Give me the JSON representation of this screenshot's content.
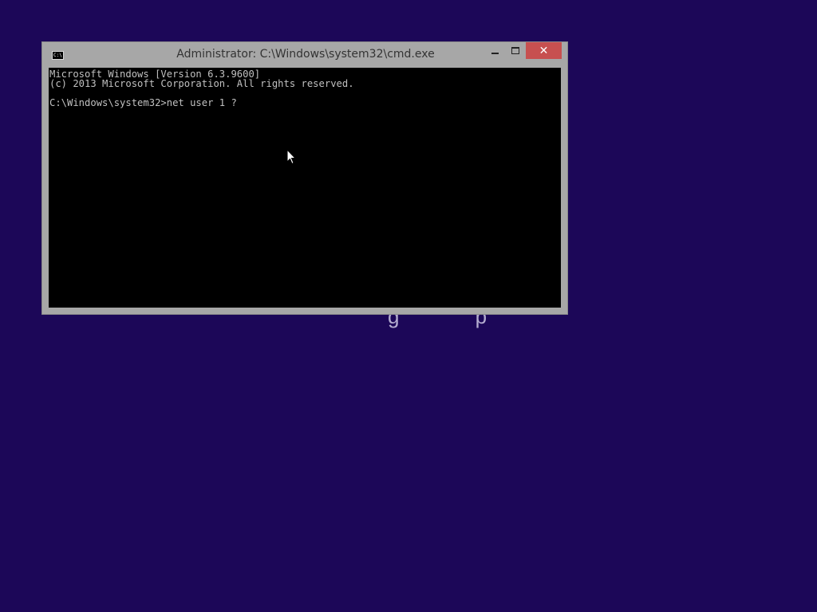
{
  "desktop": {
    "background_color": "#1c0758",
    "partial_text": "g    p"
  },
  "window": {
    "title": "Administrator: C:\\Windows\\system32\\cmd.exe",
    "icon": "cmd-icon",
    "icon_label": "C:\\",
    "close_color": "#c75050",
    "controls": {
      "minimize": "minimize-icon",
      "maximize": "maximize-icon",
      "close": "✕"
    }
  },
  "console": {
    "background": "#000000",
    "text_color": "#c0c0c0",
    "lines": [
      "Microsoft Windows [Version 6.3.9600]",
      "(c) 2013 Microsoft Corporation. All rights reserved.",
      "",
      "C:\\Windows\\system32>net user 1 ?"
    ]
  }
}
